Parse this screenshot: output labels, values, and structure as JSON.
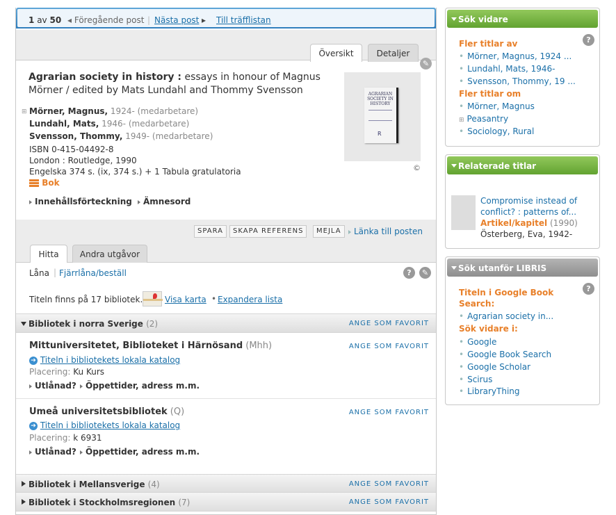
{
  "nav": {
    "current": "1",
    "of": "av",
    "total": "50",
    "prev": "Föregående post",
    "next": "Nästa post",
    "hits": "Till träfflistan"
  },
  "tabs": {
    "overview": "Översikt",
    "details": "Detaljer"
  },
  "record": {
    "title_bold": "Agrarian society in history :",
    "title_rest": "essays in honour of Magnus",
    "title_line2": "Mörner / edited by Mats Lundahl and Thommy Svensson",
    "authors": [
      {
        "name": "Mörner, Magnus,",
        "years": "1924-",
        "role": "(medarbetare)"
      },
      {
        "name": "Lundahl, Mats,",
        "years": "1946-",
        "role": "(medarbetare)"
      },
      {
        "name": "Svensson, Thommy,",
        "years": "1949-",
        "role": "(medarbetare)"
      }
    ],
    "isbn": "ISBN 0-415-04492-8",
    "publisher": "London : Routledge, 1990",
    "extent": "Engelska 374 s. (ix, 374 s.) + 1 Tabula gratulatoria",
    "type": "Bok",
    "copyright": "©",
    "cover_text": "AGRARIAN SOCIETY IN HISTORY",
    "toc": "Innehållsförteckning",
    "subjects": "Ämnesord"
  },
  "actions": {
    "save": "SPARA",
    "ref": "SKAPA REFERENS",
    "mail": "MEJLA",
    "link": "Länka till posten"
  },
  "find_tabs": {
    "find": "Hitta",
    "editions": "Andra utgåvor"
  },
  "loan": {
    "borrow": "Låna",
    "ill": "Fjärrlåna/beställ"
  },
  "libs_info": {
    "text": "Titeln finns på 17 bibliotek.",
    "map": "Visa karta",
    "expand": "Expandera lista"
  },
  "regions": [
    {
      "name": "Bibliotek i norra Sverige",
      "count": "(2)",
      "fav": "ANGE SOM FAVORIT"
    },
    {
      "name": "Bibliotek i Mellansverige",
      "count": "(4)",
      "fav": "ANGE SOM FAVORIT"
    },
    {
      "name": "Bibliotek i Stockholmsregionen",
      "count": "(7)",
      "fav": "ANGE SOM FAVORIT"
    }
  ],
  "libraries": [
    {
      "name": "Mittuniversitetet, Biblioteket i Härnösand",
      "code": "(Mhh)",
      "catalog": "Titeln i bibliotekets lokala katalog",
      "placing_label": "Placering:",
      "placing": "Ku Kurs",
      "loaned": "Utlånad?",
      "hours": "Öppettider, adress m.m.",
      "fav": "ANGE SOM FAVORIT"
    },
    {
      "name": "Umeå universitetsbibliotek",
      "code": "(Q)",
      "catalog": "Titeln i bibliotekets lokala katalog",
      "placing_label": "Placering:",
      "placing": "k 6931",
      "loaned": "Utlånad?",
      "hours": "Öppettider, adress m.m.",
      "fav": "ANGE SOM FAVORIT"
    }
  ],
  "search_more": {
    "title": "Sök vidare",
    "more_by": "Fler titlar av",
    "by_items": [
      "Mörner, Magnus, 1924 ...",
      "Lundahl, Mats, 1946-",
      "Svensson, Thommy, 19 ..."
    ],
    "more_about": "Fler titlar om",
    "about_items": [
      "Mörner, Magnus",
      "Peasantry",
      "Sociology, Rural"
    ]
  },
  "related": {
    "title": "Relaterade titlar",
    "item_title1": "Compromise instead of",
    "item_title2": "conflict? : patterns of...",
    "item_type": "Artikel/kapitel",
    "item_year": "(1990)",
    "item_author": "Österberg, Eva, 1942-"
  },
  "outside": {
    "title": "Sök utanför LIBRIS",
    "google_label1": "Titeln i Google Book",
    "google_label2": "Search:",
    "google_item": "Agrarian society in...",
    "search_more_label": "Sök vidare i:",
    "links": [
      "Google",
      "Google Book Search",
      "Google Scholar",
      "Scirus",
      "LibraryThing"
    ]
  },
  "icons": {
    "help": "?",
    "wrench": "🔧"
  }
}
